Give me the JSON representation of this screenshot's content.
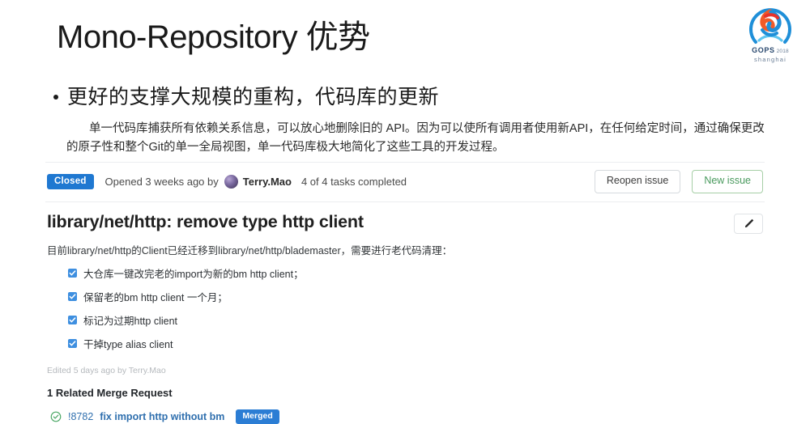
{
  "slide": {
    "title": "Mono-Repository 优势",
    "bullet": "更好的支撑大规模的重构，代码库的更新",
    "paragraph": "单一代码库捕获所有依赖关系信息，可以放心地删除旧的 API。因为可以使所有调用者使用新API，在任何给定时间，通过确保更改的原子性和整个Git的单一全局视图，单一代码库极大地简化了这些工具的开发过程。"
  },
  "logo": {
    "wordmark": "GOPS",
    "year": "2018",
    "city": "shanghai",
    "colors": {
      "orange": "#f05a28",
      "red": "#e8332a",
      "blue": "#1f8fd8",
      "light_blue": "#5ec5ef",
      "navy": "#2b4a6f"
    }
  },
  "issue": {
    "status_badge": "Closed",
    "opened_text": "Opened 3 weeks ago by",
    "author": "Terry.Mao",
    "tasks_completed": "4 of 4 tasks completed",
    "reopen_button": "Reopen issue",
    "new_issue_button": "New issue",
    "title": "library/net/http: remove type http client",
    "edit_icon": "pencil-icon",
    "description": "目前library/net/http的Client已经迁移到library/net/http/blademaster，需要进行老代码清理：",
    "tasks": [
      {
        "checked": true,
        "label": "大仓库一键改完老的import为新的bm http client；"
      },
      {
        "checked": true,
        "label": "保留老的bm http client 一个月；"
      },
      {
        "checked": true,
        "label": "标记为过期http client"
      },
      {
        "checked": true,
        "label": "干掉type alias client"
      }
    ],
    "edited_note": "Edited 5 days ago by Terry.Mao",
    "related_heading": "1 Related Merge Request",
    "merge_request": {
      "status_icon": "check-circle-icon",
      "id": "!8782",
      "title": "fix import http without bm",
      "badge": "Merged"
    },
    "colors": {
      "closed_badge": "#1f78d1",
      "merged_badge": "#2b7dd4",
      "link": "#2f6fae",
      "checkbox": "#3e8fe0",
      "green_outline": "#a6cfa6",
      "check_circle": "#4aa764"
    }
  }
}
